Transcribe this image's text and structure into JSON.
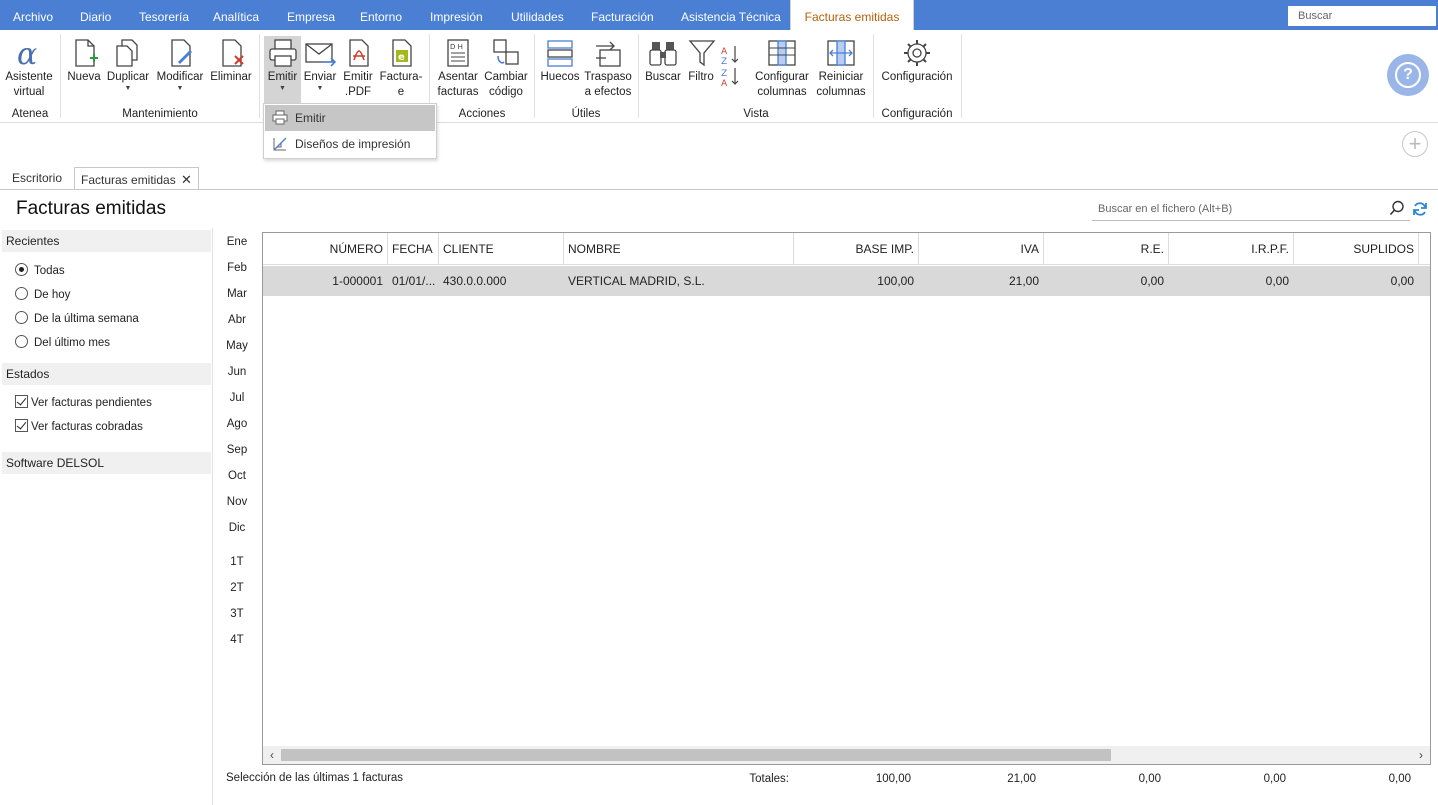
{
  "menu": {
    "tabs": [
      "Archivo",
      "Diario",
      "Tesorería",
      "Analítica",
      "Empresa",
      "Entorno",
      "Impresión",
      "Utilidades",
      "Facturación",
      "Asistencia Técnica",
      "Facturas emitidas"
    ],
    "active_tab": "Facturas emitidas",
    "search_placeholder": "Buscar",
    "accent_color": "#4a7fd4"
  },
  "ribbon": {
    "groups": {
      "atenea": "Atenea",
      "mantenimiento": "Mantenimiento",
      "acciones": "Acciones",
      "utiles": "Útiles",
      "vista": "Vista",
      "configuracion": "Configuración"
    },
    "buttons": {
      "asistente": [
        "Asistente",
        "virtual"
      ],
      "nueva": "Nueva",
      "duplicar": "Duplicar",
      "modificar": "Modificar",
      "eliminar": "Eliminar",
      "emitir": "Emitir",
      "enviar": "Enviar",
      "emitir_pdf": [
        "Emitir",
        ".PDF"
      ],
      "facturae": [
        "Factura-",
        "e"
      ],
      "asentar": [
        "Asentar",
        "facturas"
      ],
      "cambiar": [
        "Cambiar",
        "código"
      ],
      "huecos": "Huecos",
      "traspaso": [
        "Traspaso",
        "a efectos"
      ],
      "buscar": "Buscar",
      "filtro": "Filtro",
      "configurar_columnas": [
        "Configurar",
        "columnas"
      ],
      "reiniciar_columnas": [
        "Reiniciar",
        "columnas"
      ],
      "configuracion": "Configuración"
    },
    "emitir_menu": [
      "Emitir",
      "Diseños de impresión"
    ]
  },
  "doc_tabs": [
    "Escritorio",
    "Facturas emitidas"
  ],
  "page": {
    "title": "Facturas emitidas",
    "search_placeholder": "Buscar en el fichero (Alt+B)"
  },
  "sidebar": {
    "recientes_title": "Recientes",
    "recientes": [
      {
        "label": "Todas",
        "selected": true
      },
      {
        "label": "De hoy",
        "selected": false
      },
      {
        "label": "De la última semana",
        "selected": false
      },
      {
        "label": "Del último mes",
        "selected": false
      }
    ],
    "estados_title": "Estados",
    "estados": [
      {
        "label": "Ver facturas pendientes",
        "checked": true
      },
      {
        "label": "Ver facturas cobradas",
        "checked": true
      }
    ],
    "software_title": "Software DELSOL"
  },
  "months": [
    "Ene",
    "Feb",
    "Mar",
    "Abr",
    "May",
    "Jun",
    "Jul",
    "Ago",
    "Sep",
    "Oct",
    "Nov",
    "Dic"
  ],
  "quarters": [
    "1T",
    "2T",
    "3T",
    "4T"
  ],
  "table": {
    "columns": [
      "NÚMERO",
      "FECHA",
      "CLIENTE",
      "NOMBRE",
      "BASE IMP.",
      "IVA",
      "R.E.",
      "I.R.P.F.",
      "SUPLIDOS"
    ],
    "rows": [
      [
        "1-000001",
        "01/01/...",
        "430.0.0.000",
        "VERTICAL MADRID, S.L.",
        "100,00",
        "21,00",
        "0,00",
        "0,00",
        "0,00"
      ]
    ]
  },
  "footer": {
    "selection": "Selección de las últimas 1 facturas",
    "totals_label": "Totales:",
    "totals": [
      "100,00",
      "21,00",
      "0,00",
      "0,00",
      "0,00"
    ]
  }
}
